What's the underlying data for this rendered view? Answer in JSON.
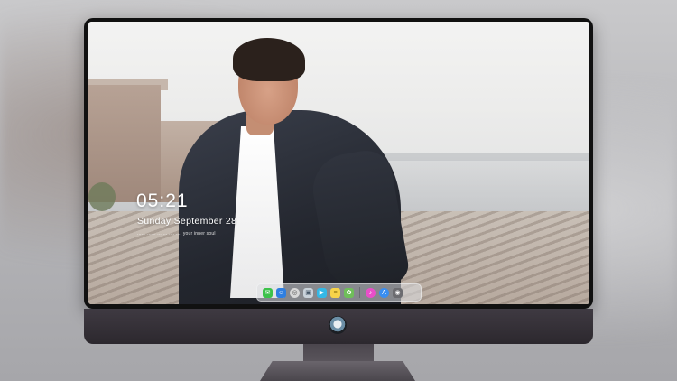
{
  "lock_screen": {
    "time": "05:21",
    "date": "Sunday September 28",
    "subtitle": "...... ...... ... ... .... .... your inner soul"
  },
  "dock": {
    "items": [
      {
        "icon": "messages-icon",
        "color": "#3cc24a"
      },
      {
        "icon": "finder-icon",
        "color": "#2f7fe0"
      },
      {
        "icon": "launchpad-icon",
        "color": "#d8d8d8"
      },
      {
        "icon": "preview-icon",
        "color": "#c9d2da"
      },
      {
        "icon": "video-icon",
        "color": "#34b8e6"
      },
      {
        "icon": "notes-icon",
        "color": "#f6d34a"
      },
      {
        "icon": "photos-icon",
        "color": "#6fbf5a"
      },
      {
        "icon": "itunes-icon",
        "color": "#e84fc9"
      },
      {
        "icon": "app-store-icon",
        "color": "#3a8ef0"
      },
      {
        "icon": "camera-icon",
        "color": "#6c6c70"
      }
    ]
  },
  "monitor": {
    "logo": "alienware-icon"
  }
}
